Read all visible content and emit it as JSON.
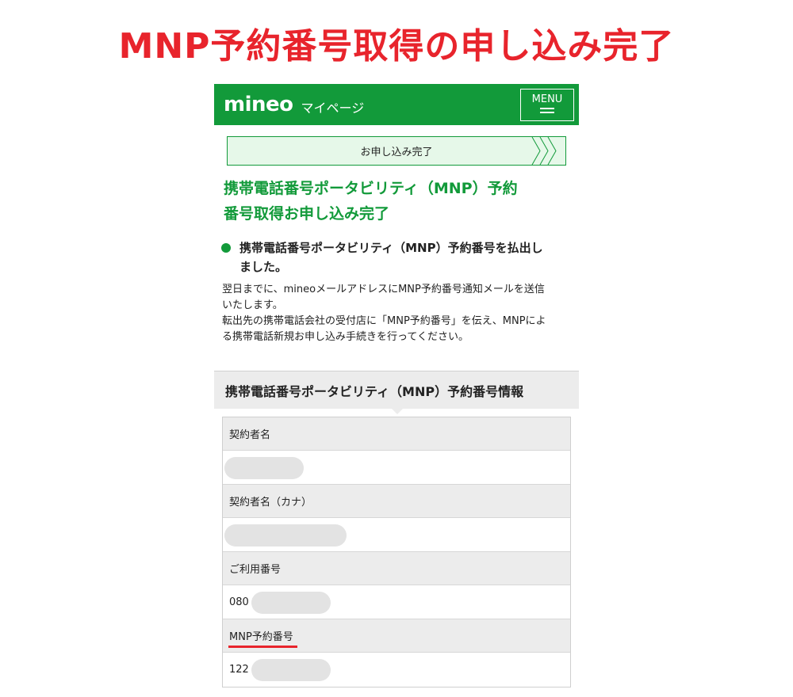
{
  "headline": "MNP予約番号取得の申し込み完了",
  "header": {
    "logo": "mineo",
    "subtitle": "マイページ",
    "menu_label": "MENU"
  },
  "steps": {
    "current": "お申し込み完了"
  },
  "page_title": {
    "line1": "携帯電話番号ポータビリティ（MNP）予約",
    "line2": "番号取得お申し込み完了"
  },
  "notice": {
    "line1": "携帯電話番号ポータビリティ（MNP）予約番号を払出し",
    "line2": "ました。"
  },
  "description": {
    "line1": "翌日までに、mineoメールアドレスにMNP予約番号通知メールを送信",
    "line2": "いたします。",
    "line3": "転出先の携帯電話会社の受付店に「MNP予約番号」を伝え、MNPによ",
    "line4": "る携帯電話新規お申し込み手続きを行ってください。"
  },
  "info_section": {
    "title": "携帯電話番号ポータビリティ（MNP）予約番号情報",
    "rows": [
      {
        "label": "契約者名",
        "value": ""
      },
      {
        "label": "契約者名（カナ）",
        "value": ""
      },
      {
        "label": "ご利用番号",
        "value": "080"
      },
      {
        "label": "MNP予約番号",
        "value": "122"
      }
    ]
  },
  "colors": {
    "brand_green": "#129a3a",
    "headline_red": "#e8242c",
    "step_bg": "#e6f8e9"
  }
}
